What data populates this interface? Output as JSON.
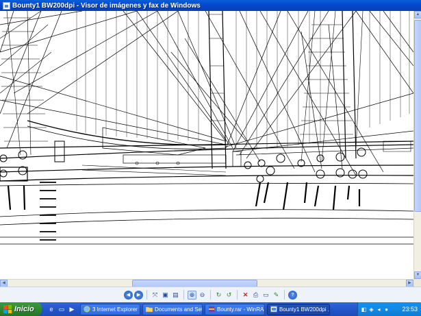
{
  "window": {
    "title": "Bounty1 BW200dpi - Visor de imágenes y fax de Windows"
  },
  "viewer_toolbar": {
    "buttons": [
      {
        "icon": "previous-image-icon"
      },
      {
        "icon": "next-image-icon"
      },
      {
        "icon": "best-fit-icon"
      },
      {
        "icon": "actual-size-icon"
      },
      {
        "icon": "slideshow-icon"
      },
      {
        "icon": "zoom-in-icon"
      },
      {
        "icon": "zoom-out-icon"
      },
      {
        "icon": "rotate-clockwise-icon"
      },
      {
        "icon": "rotate-counterclockwise-icon"
      },
      {
        "icon": "delete-icon"
      },
      {
        "icon": "print-icon"
      },
      {
        "icon": "copy-to-icon"
      },
      {
        "icon": "edit-icon"
      },
      {
        "icon": "help-icon"
      }
    ]
  },
  "taskbar": {
    "start_label": "Inicio",
    "tasks": [
      {
        "label": "3 Internet Explorer",
        "icon": "internet-explorer-icon",
        "active": false
      },
      {
        "label": "Documents and Set...",
        "icon": "folder-icon",
        "active": false
      },
      {
        "label": "Bounty.rar - WinRAR",
        "icon": "winrar-icon",
        "active": false
      },
      {
        "label": "Bounty1 BW200dpi ...",
        "icon": "image-viewer-icon",
        "active": true
      }
    ],
    "clock": "23:53"
  },
  "colors": {
    "titlebar": "#0349d0",
    "taskbar": "#2456c7",
    "start_button": "#2f8a2f",
    "tray": "#128ae4"
  }
}
